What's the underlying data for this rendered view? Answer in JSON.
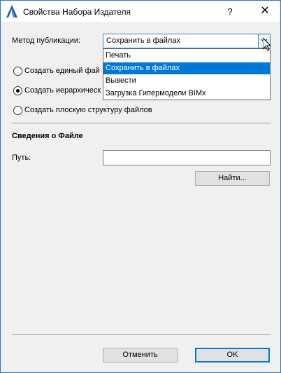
{
  "window": {
    "title": "Свойства Набора Издателя",
    "help_label": "?",
    "close_label": "✕"
  },
  "method": {
    "label": "Метод публикации:",
    "selected": "Сохранить в файлах",
    "options": [
      "Печать",
      "Сохранить в файлах",
      "Вывести",
      "Загрузка Гипермодели BIMx"
    ],
    "highlighted_index": 1
  },
  "radios": [
    {
      "label": "Создать единый фай",
      "checked": false
    },
    {
      "label": "Создать иерархическ",
      "checked": true
    },
    {
      "label": "Создать плоскую структуру файлов",
      "checked": false
    }
  ],
  "file_info": {
    "title": "Сведения о Файле",
    "path_label": "Путь:",
    "path_value": "",
    "browse_label": "Найти..."
  },
  "footer": {
    "cancel_label": "Отменить",
    "ok_label": "OK"
  },
  "colors": {
    "accent": "#0078d7",
    "window_border": "#2b78c5",
    "dialog_bg": "#f0f0f0"
  }
}
